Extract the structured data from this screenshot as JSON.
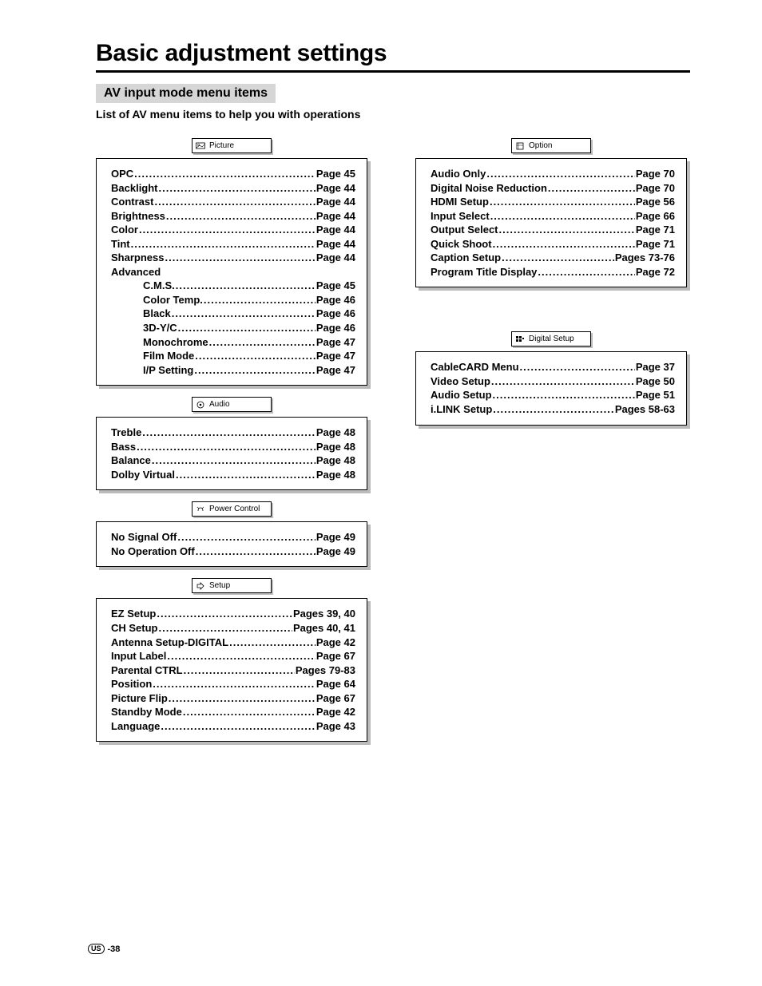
{
  "title": "Basic adjustment settings",
  "section_label": "AV input mode menu items",
  "intro": "List of AV menu items to help you with operations",
  "footer": {
    "region": "US",
    "page": "-38"
  },
  "left_groups": [
    {
      "header": "Picture",
      "items": [
        {
          "label": "OPC",
          "page": "Page 45"
        },
        {
          "label": "Backlight",
          "page": "Page 44"
        },
        {
          "label": "Contrast",
          "page": "Page 44"
        },
        {
          "label": "Brightness",
          "page": "Page 44"
        },
        {
          "label": "Color",
          "page": "Page 44"
        },
        {
          "label": "Tint",
          "page": "Page 44"
        },
        {
          "label": "Sharpness",
          "page": "Page 44"
        },
        {
          "label": "Advanced",
          "plain": true
        },
        {
          "label": "C.M.S.",
          "page": "Page 45",
          "sub": true
        },
        {
          "label": "Color Temp.",
          "page": "Page 46",
          "sub": true
        },
        {
          "label": "Black",
          "page": "Page 46",
          "sub": true
        },
        {
          "label": "3D-Y/C",
          "page": "Page 46",
          "sub": true
        },
        {
          "label": "Monochrome",
          "page": "Page 47",
          "sub": true
        },
        {
          "label": "Film Mode",
          "page": "Page 47",
          "sub": true
        },
        {
          "label": "I/P Setting",
          "page": "Page 47",
          "sub": true
        }
      ]
    },
    {
      "header": "Audio",
      "items": [
        {
          "label": "Treble",
          "page": "Page 48"
        },
        {
          "label": "Bass",
          "page": "Page 48"
        },
        {
          "label": "Balance",
          "page": "Page 48"
        },
        {
          "label": "Dolby Virtual",
          "page": "Page 48"
        }
      ]
    },
    {
      "header": "Power Control",
      "items": [
        {
          "label": "No Signal Off",
          "page": "Page 49"
        },
        {
          "label": "No Operation Off",
          "page": "Page 49"
        }
      ]
    },
    {
      "header": "Setup",
      "items": [
        {
          "label": "EZ Setup",
          "page": "Pages 39, 40"
        },
        {
          "label": "CH Setup",
          "page": "Pages 40, 41"
        },
        {
          "label": "Antenna Setup-DIGITAL",
          "page": "Page 42"
        },
        {
          "label": "Input Label",
          "page": "Page 67"
        },
        {
          "label": "Parental CTRL",
          "page": "Pages 79-83"
        },
        {
          "label": "Position",
          "page": "Page 64"
        },
        {
          "label": "Picture Flip",
          "page": "Page 67"
        },
        {
          "label": "Standby Mode",
          "page": "Page 42"
        },
        {
          "label": "Language",
          "page": "Page 43"
        }
      ]
    }
  ],
  "right_groups": [
    {
      "header": "Option",
      "items": [
        {
          "label": "Audio Only",
          "page": "Page 70"
        },
        {
          "label": "Digital Noise Reduction",
          "page": "Page 70"
        },
        {
          "label": "HDMI Setup",
          "page": "Page 56"
        },
        {
          "label": "Input Select",
          "page": "Page 66"
        },
        {
          "label": "Output Select",
          "page": "Page 71"
        },
        {
          "label": "Quick Shoot",
          "page": "Page 71"
        },
        {
          "label": "Caption Setup",
          "page": "Pages 73-76"
        },
        {
          "label": "Program Title Display",
          "page": "Page 72"
        }
      ]
    },
    {
      "header": "Digital Setup",
      "spacer": true,
      "items": [
        {
          "label": "CableCARD Menu",
          "page": "Page 37"
        },
        {
          "label": "Video Setup",
          "page": "Page 50"
        },
        {
          "label": "Audio Setup",
          "page": "Page 51"
        },
        {
          "label": "i.LINK Setup",
          "page": "Pages 58-63"
        }
      ]
    }
  ]
}
